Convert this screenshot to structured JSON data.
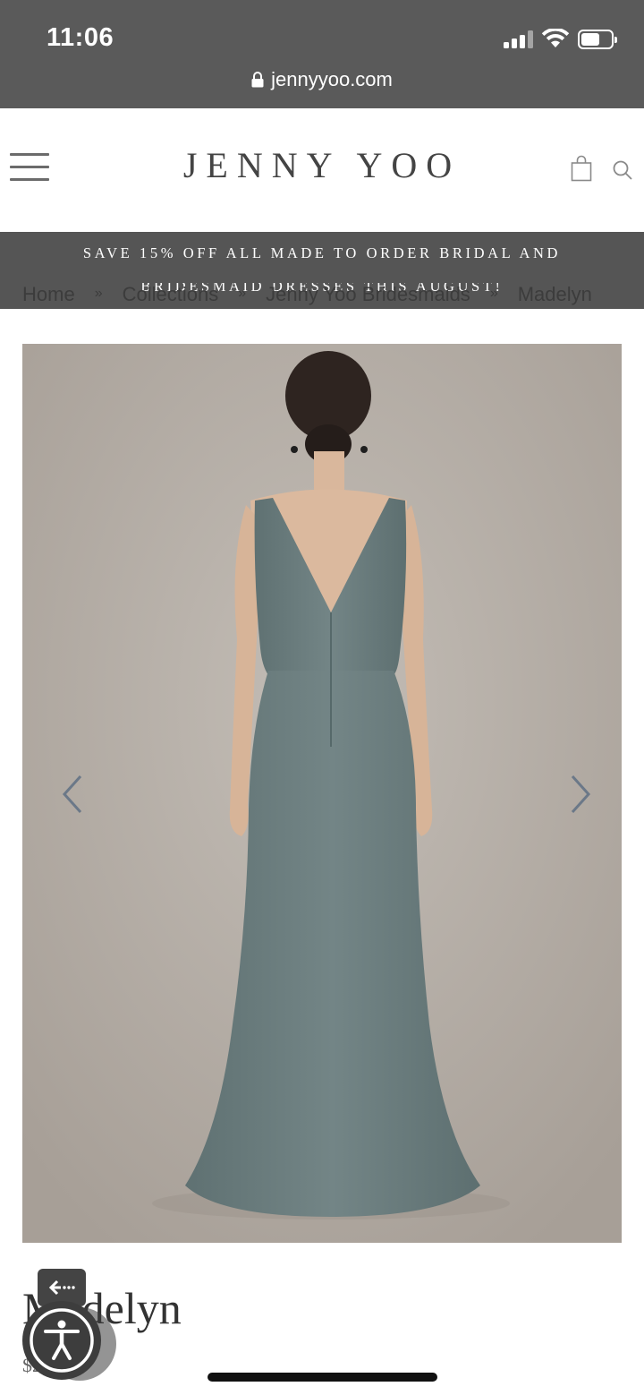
{
  "status_bar": {
    "time": "11:06",
    "signal_bars": 3,
    "signal_bars_total": 4,
    "battery_level": 0.55
  },
  "browser": {
    "url": "jennyyoo.com",
    "lock_icon": "lock-icon"
  },
  "header": {
    "brand": "JENNY YOO",
    "menu_icon": "hamburger-menu-icon",
    "cart_icon": "shopping-bag-icon",
    "search_icon": "search-icon"
  },
  "promo": {
    "line1": "SAVE 15% OFF ALL MADE TO ORDER BRIDAL AND",
    "line2": "BRIDESMAID DRESSES THIS AUGUST!"
  },
  "breadcrumb": {
    "items": [
      "Home",
      "Collections",
      "Jenny Yoo Bridesmaids",
      "Madelyn"
    ],
    "separator": "»"
  },
  "gallery": {
    "prev_icon": "chevron-left-icon",
    "next_icon": "chevron-right-icon",
    "dress_color": "#6b7d7e",
    "background_color": "#b5aea6"
  },
  "product": {
    "title": "Madelyn",
    "price": "$2"
  },
  "accessibility": {
    "back_icon": "arrow-left-icon",
    "widget_icon": "accessibility-icon"
  }
}
